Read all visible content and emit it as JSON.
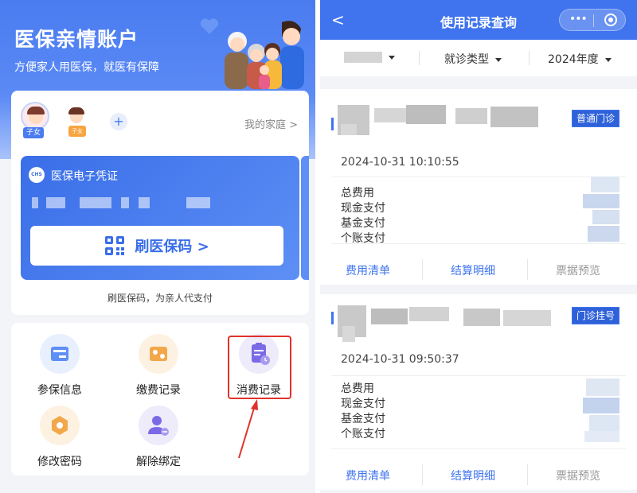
{
  "left": {
    "hero": {
      "title": "医保亲情账户",
      "subtitle": "方便家人用医保，就医有保障"
    },
    "members": [
      {
        "tag": "子女"
      },
      {
        "tag": "子女"
      }
    ],
    "add_label": "+",
    "family_link": "我的家庭 >",
    "voucher": {
      "logo_text": "CHS",
      "title": "医保电子凭证",
      "button_label": "刷医保码 >"
    },
    "hint": "刷医保码，为亲人代支付",
    "menu": [
      {
        "label": "参保信息",
        "icon": "id-card-icon",
        "color": "#e8effd"
      },
      {
        "label": "缴费记录",
        "icon": "payment-card-icon",
        "color": "#fdf1e2"
      },
      {
        "label": "消费记录",
        "icon": "clipboard-clock-icon",
        "color": "#eeebfb"
      },
      {
        "label": "修改密码",
        "icon": "hexagon-lock-icon",
        "color": "#fdf1e2"
      },
      {
        "label": "解除绑定",
        "icon": "user-unlink-icon",
        "color": "#eeebfb"
      }
    ],
    "colors": {
      "brand": "#4a7cf0",
      "highlight": "#e0322b"
    }
  },
  "right": {
    "nav": {
      "back": "<",
      "title": "使用记录查询"
    },
    "filters": [
      {
        "label": ""
      },
      {
        "label": "就诊类型"
      },
      {
        "label": "2024年度"
      }
    ],
    "records": [
      {
        "badge": "普通门诊",
        "time": "2024-10-31 10:10:55",
        "labels": [
          "总费用",
          "现金支付",
          "基金支付",
          "个账支付"
        ],
        "actions": [
          "费用清单",
          "结算明细",
          "票据预览"
        ]
      },
      {
        "badge": "门诊挂号",
        "time": "2024-10-31 09:50:37",
        "labels": [
          "总费用",
          "现金支付",
          "基金支付",
          "个账支付"
        ],
        "actions": [
          "费用清单",
          "结算明细",
          "票据预览"
        ]
      }
    ]
  }
}
